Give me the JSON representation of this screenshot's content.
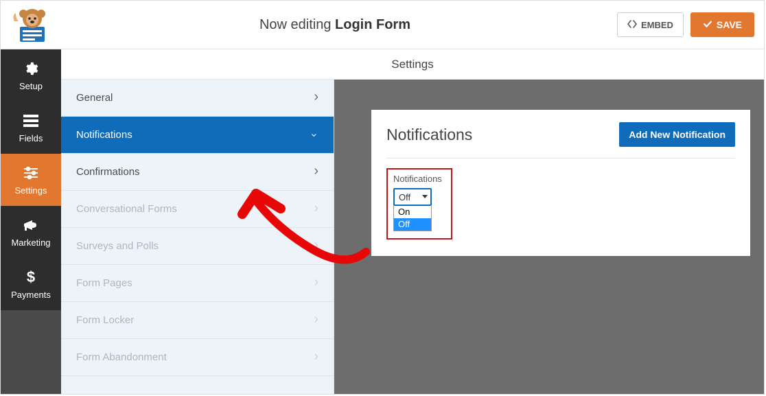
{
  "header": {
    "editing_prefix": "Now editing ",
    "form_name": "Login Form",
    "embed_label": "EMBED",
    "save_label": "SAVE"
  },
  "leftnav": {
    "items": [
      {
        "label": "Setup"
      },
      {
        "label": "Fields"
      },
      {
        "label": "Settings"
      },
      {
        "label": "Marketing"
      },
      {
        "label": "Payments"
      }
    ]
  },
  "settings_title": "Settings",
  "subnav": {
    "items": [
      {
        "label": "General"
      },
      {
        "label": "Notifications"
      },
      {
        "label": "Confirmations"
      },
      {
        "label": "Conversational Forms"
      },
      {
        "label": "Surveys and Polls"
      },
      {
        "label": "Form Pages"
      },
      {
        "label": "Form Locker"
      },
      {
        "label": "Form Abandonment"
      }
    ]
  },
  "panel": {
    "title": "Notifications",
    "add_button": "Add New Notification",
    "field_label": "Notifications",
    "selected_value": "Off",
    "options": [
      "On",
      "Off"
    ]
  }
}
